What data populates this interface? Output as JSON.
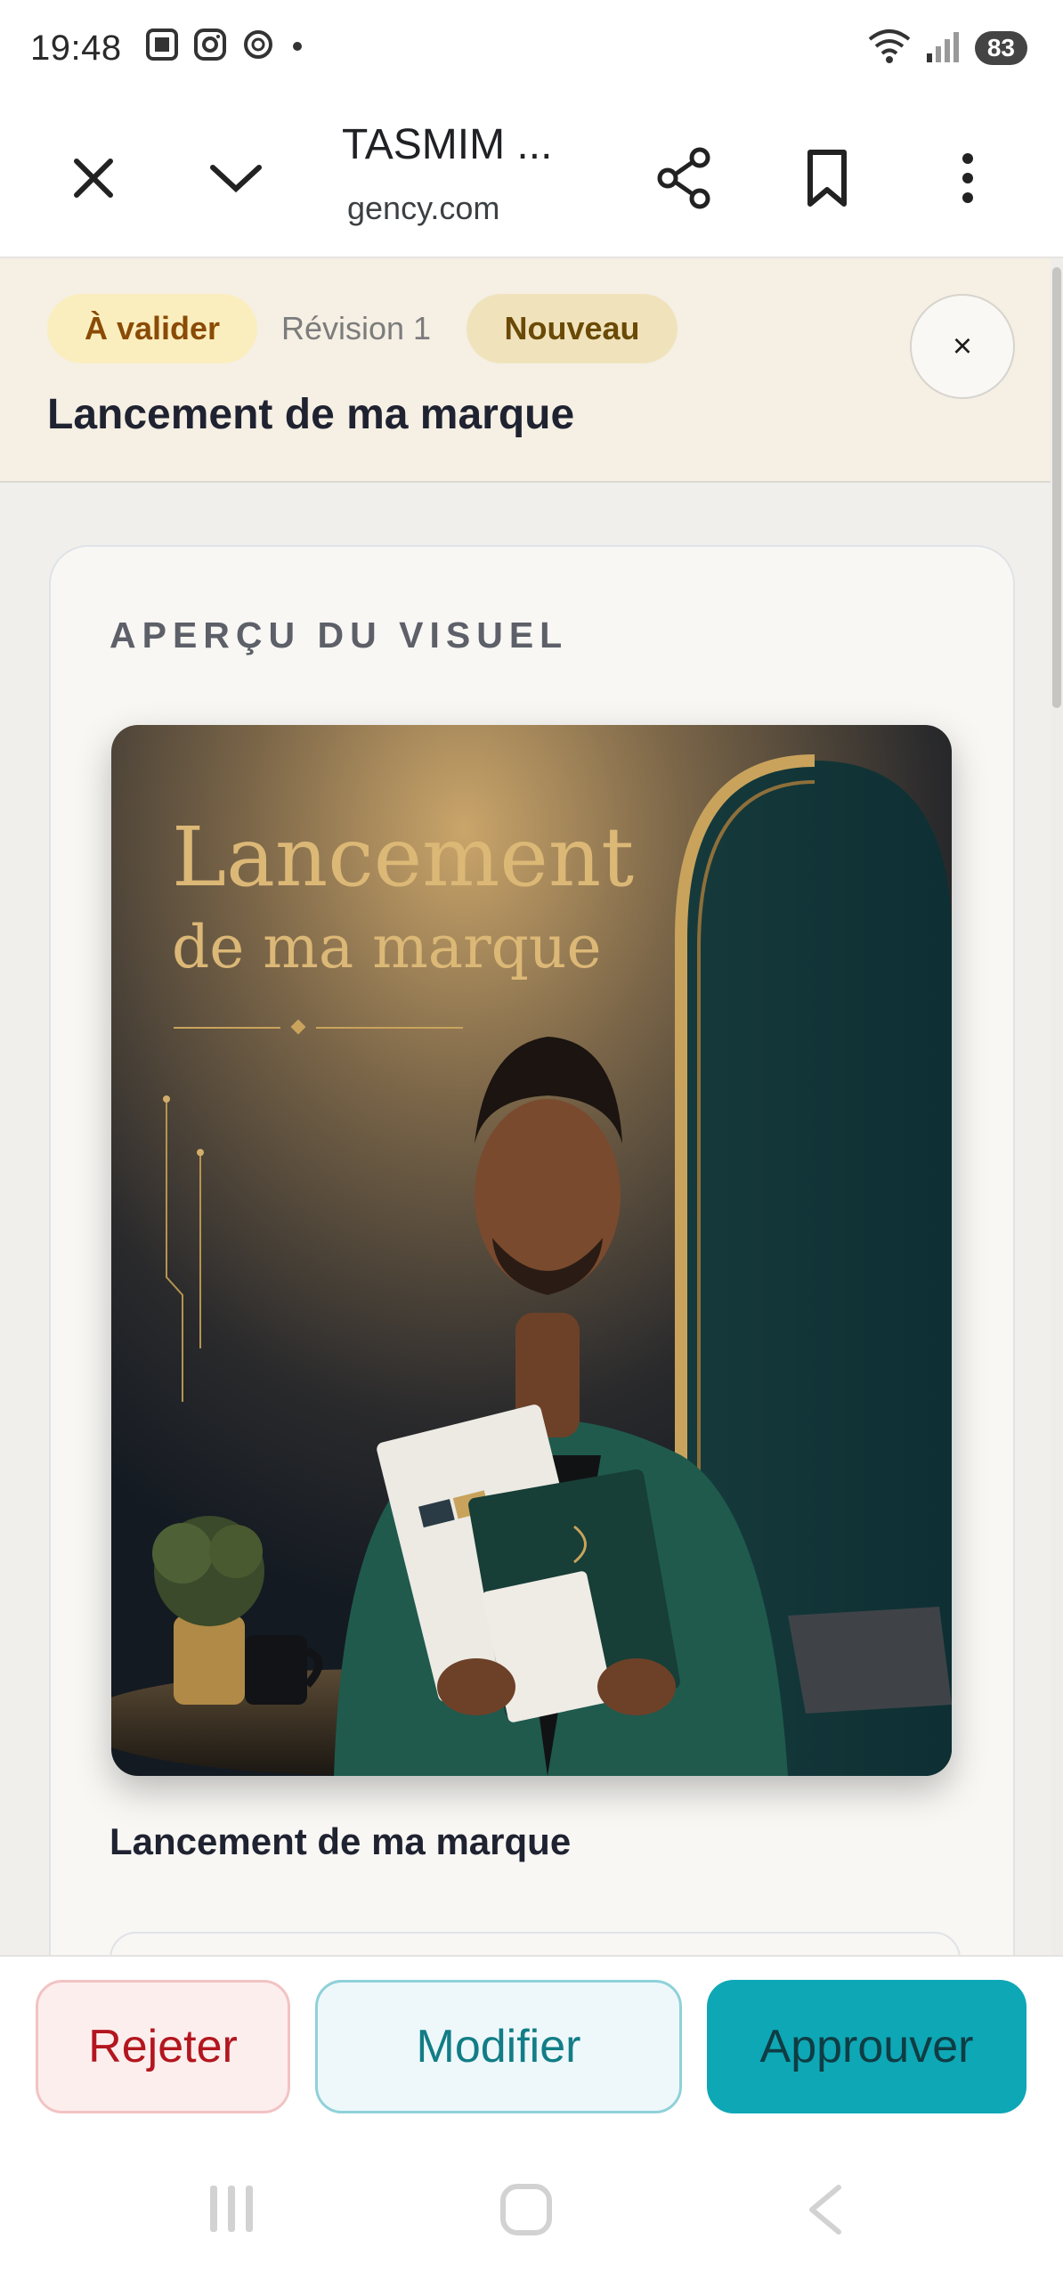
{
  "status_bar": {
    "time": "19:48",
    "battery": "83",
    "left_icons": [
      "screenshot-icon",
      "instagram-icon",
      "openai-icon",
      "dot-icon"
    ],
    "right_icons": [
      "wifi-icon",
      "signal-icon",
      "battery-icon"
    ]
  },
  "browser": {
    "title": "TASMIM ...",
    "url": "gency.com",
    "buttons": [
      "close-icon",
      "chevron-down-icon",
      "share-icon",
      "bookmark-icon",
      "more-vert-icon"
    ]
  },
  "header": {
    "status_badge": "À valider",
    "revision": "Révision 1",
    "new_badge": "Nouveau",
    "close_glyph": "×",
    "title": "Lancement de ma marque"
  },
  "card": {
    "section_label": "APERÇU DU VISUEL",
    "preview": {
      "headline_line1": "Lancement",
      "headline_line2": "de ma marque"
    },
    "caption": "Lancement de ma marque"
  },
  "actions": {
    "reject": "Rejeter",
    "modify": "Modifier",
    "approve": "Approuver"
  },
  "colors": {
    "accent": "#0ea7b6",
    "reject": "#b3161e",
    "badge_warning_bg": "#fbeebe",
    "gold": "#d9b36a"
  },
  "nav": [
    "recents-icon",
    "home-icon",
    "back-icon"
  ]
}
